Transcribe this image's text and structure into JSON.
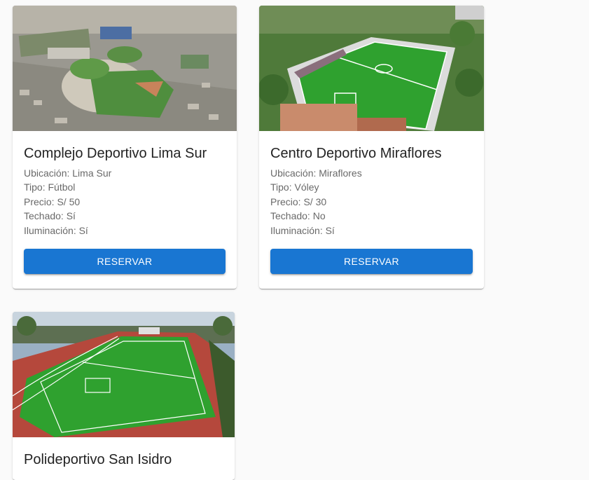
{
  "cards": [
    {
      "title": "Complejo Deportivo Lima Sur",
      "details": [
        "Ubicación: Lima Sur",
        "Tipo: Fútbol",
        "Precio: S/ 50",
        "Techado: Sí",
        "Iluminación: Sí"
      ],
      "button_label": "RESERVAR",
      "image": "aerial-stadium-photo"
    },
    {
      "title": "Centro Deportivo Miraflores",
      "details": [
        "Ubicación: Miraflores",
        "Tipo: Vóley",
        "Precio: S/ 30",
        "Techado: No",
        "Iluminación: Sí"
      ],
      "button_label": "RESERVAR",
      "image": "aerial-soccer-field-photo"
    },
    {
      "title": "Polideportivo San Isidro",
      "image": "soccer-field-with-track-photo"
    }
  ],
  "colors": {
    "primary": "#1976d2",
    "field_green": "#2fa12f",
    "track_red": "#b5483c"
  }
}
